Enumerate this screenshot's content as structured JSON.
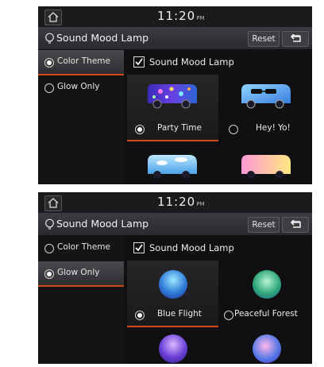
{
  "status_bar": {
    "time": "11:20",
    "ampm": "PM"
  },
  "screens": [
    {
      "title": "Sound Mood Lamp",
      "reset_label": "Reset",
      "options": [
        {
          "label": "Color Theme",
          "selected": true
        },
        {
          "label": "Glow Only",
          "selected": false
        }
      ],
      "lamp_toggle": {
        "label": "Sound Mood Lamp",
        "checked": true
      },
      "items": [
        {
          "label": "Party Time",
          "selected": true,
          "image": "party-van-image"
        },
        {
          "label": "Hey! Yo!",
          "selected": false,
          "image": "cool-van-image"
        },
        {
          "label": "",
          "image": "sky-van-image"
        },
        {
          "label": "",
          "image": "pink-van-image"
        }
      ]
    },
    {
      "title": "Sound Mood Lamp",
      "reset_label": "Reset",
      "options": [
        {
          "label": "Color Theme",
          "selected": false
        },
        {
          "label": "Glow Only",
          "selected": true
        }
      ],
      "lamp_toggle": {
        "label": "Sound Mood Lamp",
        "checked": true
      },
      "items": [
        {
          "label": "Blue Flight",
          "selected": true,
          "image": "blue-orb-image"
        },
        {
          "label": "Peaceful Forest",
          "selected": false,
          "image": "green-orb-image"
        },
        {
          "label": "",
          "image": "purple-orb-image"
        },
        {
          "label": "",
          "image": "blue-purple-orb-image"
        }
      ]
    }
  ],
  "icons": [
    "home-icon",
    "bulb-icon",
    "back-arrow-icon",
    "check-icon"
  ],
  "colors": {
    "accent": "#d24a14",
    "background": "#101012",
    "title_bar": "#35353a"
  }
}
